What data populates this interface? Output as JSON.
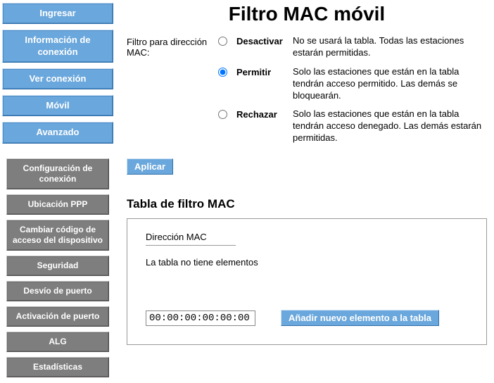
{
  "title": "Filtro MAC móvil",
  "nav_primary": [
    {
      "id": "ingresar",
      "label": "Ingresar"
    },
    {
      "id": "info-conexion",
      "label": "Información de conexión"
    },
    {
      "id": "ver-conexion",
      "label": "Ver conexión"
    },
    {
      "id": "movil",
      "label": "Móvil"
    },
    {
      "id": "avanzado",
      "label": "Avanzado"
    }
  ],
  "nav_secondary": [
    {
      "id": "config-conexion",
      "label": "Configuración de conexión"
    },
    {
      "id": "ubicacion-ppp",
      "label": "Ubicación PPP"
    },
    {
      "id": "cambiar-codigo",
      "label": "Cambiar código de acceso del dispositivo"
    },
    {
      "id": "seguridad",
      "label": "Seguridad"
    },
    {
      "id": "desvio-puerto",
      "label": "Desvío de puerto"
    },
    {
      "id": "activacion-puerto",
      "label": "Activación de puerto"
    },
    {
      "id": "alg",
      "label": "ALG"
    },
    {
      "id": "estadisticas",
      "label": "Estadísticas"
    }
  ],
  "filter": {
    "label": "Filtro para dirección MAC:",
    "selected": "permitir",
    "options": [
      {
        "id": "desactivar",
        "name": "Desactivar",
        "desc": "No se usará la tabla. Todas las estaciones estarán permitidas."
      },
      {
        "id": "permitir",
        "name": "Permitir",
        "desc": "Solo las estaciones que están en la tabla tendrán acceso permitido. Las demás se bloquearán."
      },
      {
        "id": "rechazar",
        "name": "Rechazar",
        "desc": "Solo las estaciones que están en la tabla tendrán acceso denegado. Las demás estarán permitidas."
      }
    ],
    "apply_label": "Aplicar"
  },
  "table": {
    "heading": "Tabla de filtro MAC",
    "col_header": "Dirección MAC",
    "empty_msg": "La tabla no tiene elementos",
    "mac_value": "00:00:00:00:00:00",
    "add_label": "Añadir nuevo elemento a la tabla"
  }
}
